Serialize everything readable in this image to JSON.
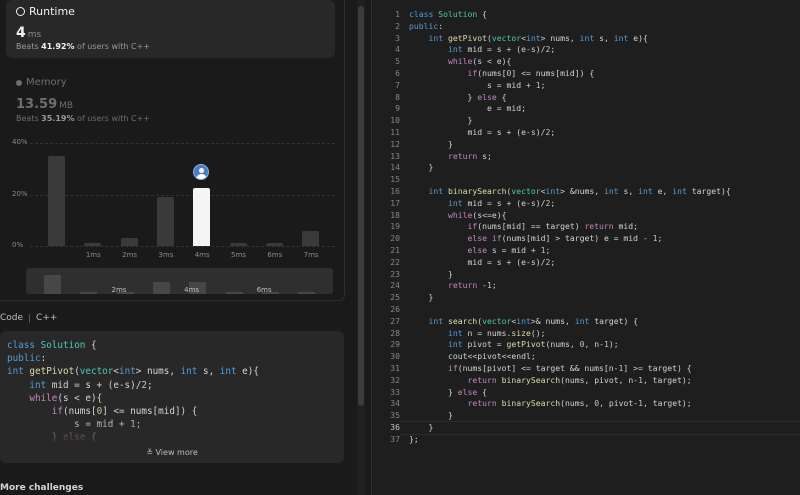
{
  "runtime": {
    "title": "Runtime",
    "value": "4",
    "unit": "ms",
    "beats_prefix": "Beats",
    "beats_pct": "41.92%",
    "beats_suffix": "of users with C++"
  },
  "memory": {
    "title": "Memory",
    "value": "13.59",
    "unit": "MB",
    "beats_prefix": "Beats",
    "beats_pct": "35.19%",
    "beats_suffix": "of users with C++"
  },
  "chart_data": {
    "type": "bar",
    "categories": [
      "",
      "1ms",
      "2ms",
      "3ms",
      "4ms",
      "5ms",
      "6ms",
      "7ms"
    ],
    "values": [
      35,
      1,
      3,
      19,
      22.5,
      1,
      1,
      6
    ],
    "selected_index": 4,
    "y_ticks": [
      "40%",
      "20%",
      "0%"
    ],
    "ylim": [
      0,
      40
    ],
    "mini_labels": [
      "2ms",
      "4ms",
      "6ms"
    ],
    "mini_values": [
      8,
      1,
      1,
      5,
      5,
      1,
      1,
      1
    ]
  },
  "code_header": {
    "tab": "Code",
    "lang": "C++"
  },
  "preview_code": "class Solution {\npublic:\nint getPivot(vector<int> nums, int s, int e){\n    int mid = s + (e-s)/2;\n    while(s < e){\n        if(nums[0] <= nums[mid]) {\n            s = mid + 1;\n        } else {",
  "view_more": "View more",
  "more_challenges": "More challenges",
  "editor": {
    "current_line": 36,
    "lines": [
      "class Solution {",
      "public:",
      "    int getPivot(vector<int> nums, int s, int e){",
      "        int mid = s + (e-s)/2;",
      "        while(s < e){",
      "            if(nums[0] <= nums[mid]) {",
      "                s = mid + 1;",
      "            } else {",
      "                e = mid;",
      "            }",
      "            mid = s + (e-s)/2;",
      "        }",
      "        return s;",
      "    }",
      "",
      "    int binarySearch(vector<int> &nums, int s, int e, int target){",
      "        int mid = s + (e-s)/2;",
      "        while(s<=e){",
      "            if(nums[mid] == target) return mid;",
      "            else if(nums[mid] > target) e = mid - 1;",
      "            else s = mid + 1;",
      "            mid = s + (e-s)/2;",
      "        }",
      "        return -1;",
      "    }",
      "",
      "    int search(vector<int>& nums, int target) {",
      "        int n = nums.size();",
      "        int pivot = getPivot(nums, 0, n-1);",
      "        cout<<pivot<<endl;",
      "        if(nums[pivot] <= target && nums[n-1] >= target) {",
      "            return binarySearch(nums, pivot, n-1, target);",
      "        } else {",
      "            return binarySearch(nums, 0, pivot-1, target);",
      "        }",
      "    }",
      "};"
    ]
  }
}
